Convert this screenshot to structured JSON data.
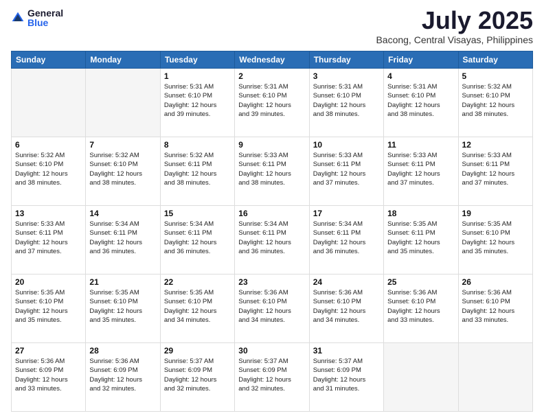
{
  "logo": {
    "general": "General",
    "blue": "Blue"
  },
  "title": "July 2025",
  "location": "Bacong, Central Visayas, Philippines",
  "days_of_week": [
    "Sunday",
    "Monday",
    "Tuesday",
    "Wednesday",
    "Thursday",
    "Friday",
    "Saturday"
  ],
  "weeks": [
    [
      {
        "day": "",
        "info": ""
      },
      {
        "day": "",
        "info": ""
      },
      {
        "day": "1",
        "sunrise": "5:31 AM",
        "sunset": "6:10 PM",
        "daylight": "12 hours and 39 minutes."
      },
      {
        "day": "2",
        "sunrise": "5:31 AM",
        "sunset": "6:10 PM",
        "daylight": "12 hours and 39 minutes."
      },
      {
        "day": "3",
        "sunrise": "5:31 AM",
        "sunset": "6:10 PM",
        "daylight": "12 hours and 38 minutes."
      },
      {
        "day": "4",
        "sunrise": "5:31 AM",
        "sunset": "6:10 PM",
        "daylight": "12 hours and 38 minutes."
      },
      {
        "day": "5",
        "sunrise": "5:32 AM",
        "sunset": "6:10 PM",
        "daylight": "12 hours and 38 minutes."
      }
    ],
    [
      {
        "day": "6",
        "sunrise": "5:32 AM",
        "sunset": "6:10 PM",
        "daylight": "12 hours and 38 minutes."
      },
      {
        "day": "7",
        "sunrise": "5:32 AM",
        "sunset": "6:10 PM",
        "daylight": "12 hours and 38 minutes."
      },
      {
        "day": "8",
        "sunrise": "5:32 AM",
        "sunset": "6:11 PM",
        "daylight": "12 hours and 38 minutes."
      },
      {
        "day": "9",
        "sunrise": "5:33 AM",
        "sunset": "6:11 PM",
        "daylight": "12 hours and 38 minutes."
      },
      {
        "day": "10",
        "sunrise": "5:33 AM",
        "sunset": "6:11 PM",
        "daylight": "12 hours and 37 minutes."
      },
      {
        "day": "11",
        "sunrise": "5:33 AM",
        "sunset": "6:11 PM",
        "daylight": "12 hours and 37 minutes."
      },
      {
        "day": "12",
        "sunrise": "5:33 AM",
        "sunset": "6:11 PM",
        "daylight": "12 hours and 37 minutes."
      }
    ],
    [
      {
        "day": "13",
        "sunrise": "5:33 AM",
        "sunset": "6:11 PM",
        "daylight": "12 hours and 37 minutes."
      },
      {
        "day": "14",
        "sunrise": "5:34 AM",
        "sunset": "6:11 PM",
        "daylight": "12 hours and 36 minutes."
      },
      {
        "day": "15",
        "sunrise": "5:34 AM",
        "sunset": "6:11 PM",
        "daylight": "12 hours and 36 minutes."
      },
      {
        "day": "16",
        "sunrise": "5:34 AM",
        "sunset": "6:11 PM",
        "daylight": "12 hours and 36 minutes."
      },
      {
        "day": "17",
        "sunrise": "5:34 AM",
        "sunset": "6:11 PM",
        "daylight": "12 hours and 36 minutes."
      },
      {
        "day": "18",
        "sunrise": "5:35 AM",
        "sunset": "6:11 PM",
        "daylight": "12 hours and 35 minutes."
      },
      {
        "day": "19",
        "sunrise": "5:35 AM",
        "sunset": "6:10 PM",
        "daylight": "12 hours and 35 minutes."
      }
    ],
    [
      {
        "day": "20",
        "sunrise": "5:35 AM",
        "sunset": "6:10 PM",
        "daylight": "12 hours and 35 minutes."
      },
      {
        "day": "21",
        "sunrise": "5:35 AM",
        "sunset": "6:10 PM",
        "daylight": "12 hours and 35 minutes."
      },
      {
        "day": "22",
        "sunrise": "5:35 AM",
        "sunset": "6:10 PM",
        "daylight": "12 hours and 34 minutes."
      },
      {
        "day": "23",
        "sunrise": "5:36 AM",
        "sunset": "6:10 PM",
        "daylight": "12 hours and 34 minutes."
      },
      {
        "day": "24",
        "sunrise": "5:36 AM",
        "sunset": "6:10 PM",
        "daylight": "12 hours and 34 minutes."
      },
      {
        "day": "25",
        "sunrise": "5:36 AM",
        "sunset": "6:10 PM",
        "daylight": "12 hours and 33 minutes."
      },
      {
        "day": "26",
        "sunrise": "5:36 AM",
        "sunset": "6:10 PM",
        "daylight": "12 hours and 33 minutes."
      }
    ],
    [
      {
        "day": "27",
        "sunrise": "5:36 AM",
        "sunset": "6:09 PM",
        "daylight": "12 hours and 33 minutes."
      },
      {
        "day": "28",
        "sunrise": "5:36 AM",
        "sunset": "6:09 PM",
        "daylight": "12 hours and 32 minutes."
      },
      {
        "day": "29",
        "sunrise": "5:37 AM",
        "sunset": "6:09 PM",
        "daylight": "12 hours and 32 minutes."
      },
      {
        "day": "30",
        "sunrise": "5:37 AM",
        "sunset": "6:09 PM",
        "daylight": "12 hours and 32 minutes."
      },
      {
        "day": "31",
        "sunrise": "5:37 AM",
        "sunset": "6:09 PM",
        "daylight": "12 hours and 31 minutes."
      },
      {
        "day": "",
        "info": ""
      },
      {
        "day": "",
        "info": ""
      }
    ]
  ]
}
